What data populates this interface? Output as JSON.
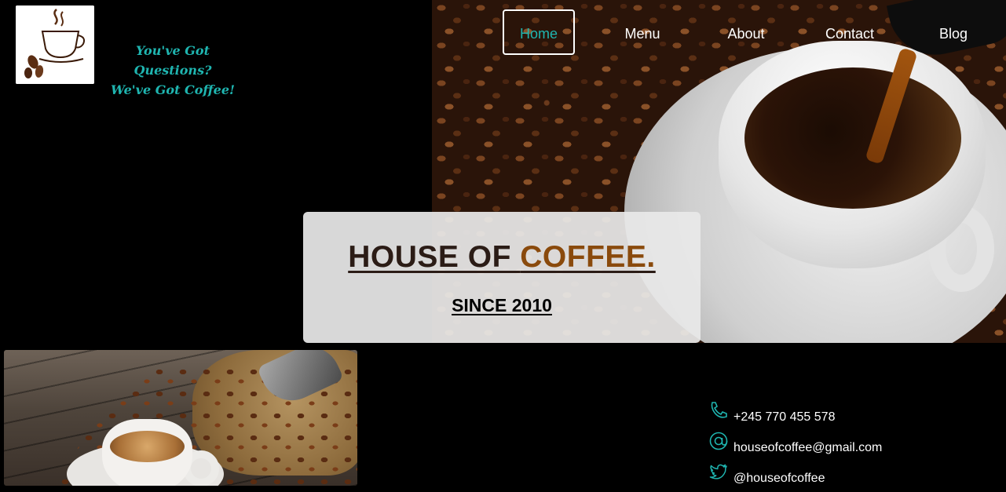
{
  "brand": {
    "logo_text": "Coffee",
    "tagline": [
      "You've Got Questions?",
      "We've Got Coffee!"
    ],
    "accent_color": "#1fb5b0"
  },
  "nav": {
    "items": [
      {
        "label": "Home",
        "active": true
      },
      {
        "label": "Menu",
        "active": false
      },
      {
        "label": "About",
        "active": false
      },
      {
        "label": "Contact",
        "active": false
      },
      {
        "label": "Blog",
        "active": false
      }
    ]
  },
  "hero": {
    "title_main": "HOUSE OF ",
    "title_accent": "COFFEE.",
    "subtitle": "SINCE 2010",
    "title_color": "#2b1c16",
    "accent_color": "#8a4a0c"
  },
  "contact": {
    "phone": {
      "icon": "phone-icon",
      "text": "+245 770 455 578"
    },
    "email": {
      "icon": "at-sign-icon",
      "text": "houseofcoffee@gmail.com"
    },
    "twitter": {
      "icon": "twitter-icon",
      "text": "@houseofcoffee"
    }
  }
}
